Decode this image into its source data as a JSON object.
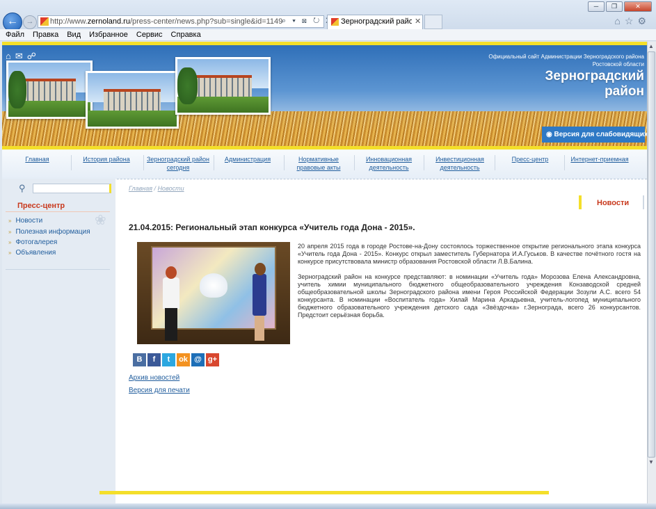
{
  "browser": {
    "url_prefix": "http://www.",
    "url_domain": "zernoland.ru",
    "url_path": "/press-center/news.php?sub=single&id=1149",
    "address_tools": "⌕ ▾ ⊠ ↻ ✕",
    "tab_title": "Зерноградский район :: Н...",
    "tab_close": "✕",
    "window_controls": [
      "─",
      "❐",
      "✕"
    ],
    "right_icons": [
      "⌂",
      "☆",
      "⚙"
    ],
    "menu": [
      "Файл",
      "Правка",
      "Вид",
      "Избранное",
      "Сервис",
      "Справка"
    ]
  },
  "header": {
    "caption_line1": "Официальный сайт Администрации Зерноградского района",
    "caption_line2": "Ростовской области",
    "site_name_line1": "Зерноградский",
    "site_name_line2": "район",
    "vision_button": "Версия для слабовидящих",
    "icons": [
      "home-icon",
      "mail-icon",
      "share-icon"
    ]
  },
  "nav": [
    {
      "label": "Главная"
    },
    {
      "label": "История района"
    },
    {
      "label": "Зерноградский район сегодня"
    },
    {
      "label": "Администрация"
    },
    {
      "label": "Нормативные правовые акты"
    },
    {
      "label": "Инновационная деятельность"
    },
    {
      "label": "Инвестиционная деятельность"
    },
    {
      "label": "Пресс-центр"
    },
    {
      "label": "Интернет-приемная"
    }
  ],
  "sidebar": {
    "heading": "Пресс-центр",
    "items": [
      {
        "label": "Новости"
      },
      {
        "label": "Полезная информация"
      },
      {
        "label": "Фотогалерея"
      },
      {
        "label": "Объявления"
      }
    ]
  },
  "content": {
    "breadcrumb_home": "Главная",
    "breadcrumb_sep": " / ",
    "breadcrumb_current": "Новости",
    "section_title": "Новости",
    "article_title": "21.04.2015: Региональный этап конкурса «Учитель года Дона - 2015».",
    "paragraph1": "20 апреля 2015 года в городе Ростове-на-Дону состоялось торжественное открытие регионального этапа конкурса «Учитель года Дона - 2015». Конкурс открыл заместитель Губернатора И.А.Гуськов. В качестве почётного гостя на конкурсе присутствовала министр образования Ростовской области Л.В.Балина.",
    "paragraph2": "Зерноградский район на конкурсе представляют: в номинации «Учитель года» Морозова Елена Александровна, учитель химии муниципального бюджетного общеобразовательного учреждения Конзаводской средней общеобразовательной школы Зерноградского района имени Героя Российской Федерации Зозули А.С. всего 54 конкурсанта. В номинации «Воспитатель года» Хилай Марина Аркадьевна, учитель-логопед муниципального бюджетного образовательного учреждения детского сада «Звёздочка» г.Зернограда, всего 26 конкурсантов. Предстоит серьёзная борьба.",
    "share_buttons": [
      {
        "label": "В",
        "color": "#4a6ea2"
      },
      {
        "label": "f",
        "color": "#3b5998"
      },
      {
        "label": "t",
        "color": "#2ca7e0"
      },
      {
        "label": "ok",
        "color": "#f39220"
      },
      {
        "label": "@",
        "color": "#1d6fb8"
      },
      {
        "label": "g+",
        "color": "#d8472f"
      }
    ],
    "archive_link": "Архив новостей",
    "print_link": "Версия для печати"
  },
  "colors": {
    "accent_yellow": "#f4df2a",
    "heading_red": "#c8381c",
    "link_blue": "#1f5c9c"
  }
}
